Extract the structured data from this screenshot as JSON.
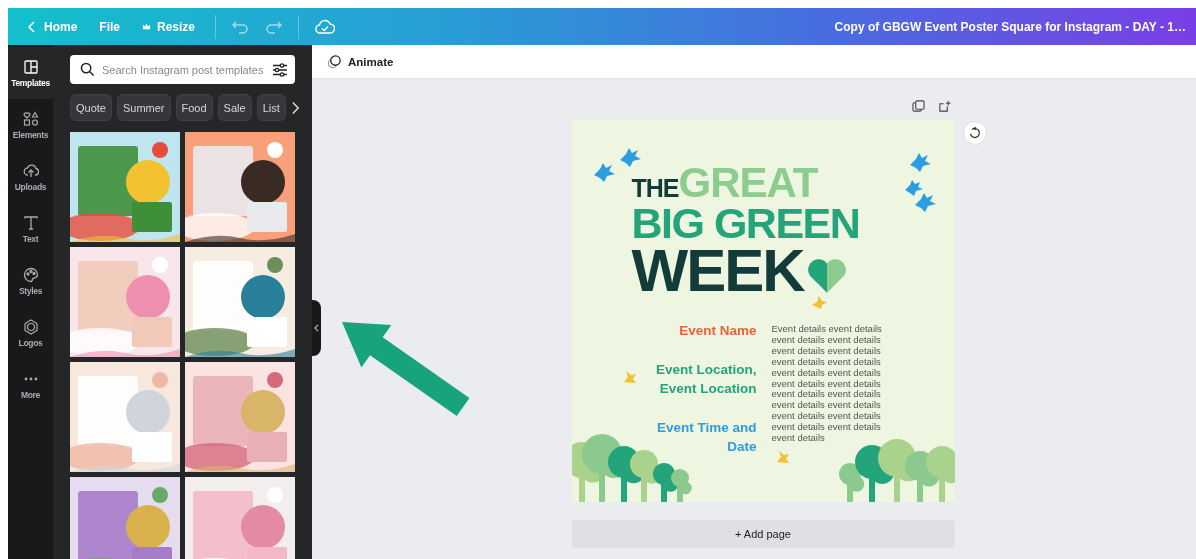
{
  "top_bar": {
    "home": "Home",
    "file": "File",
    "resize": "Resize",
    "title": "Copy of GBGW Event Poster Square for Instagram - DAY - 1…"
  },
  "rail": [
    {
      "label": "Templates",
      "selected": true,
      "kind": "templates"
    },
    {
      "label": "Elements",
      "selected": false,
      "kind": "elements"
    },
    {
      "label": "Uploads",
      "selected": false,
      "kind": "uploads"
    },
    {
      "label": "Text",
      "selected": false,
      "kind": "text"
    },
    {
      "label": "Styles",
      "selected": false,
      "kind": "styles"
    },
    {
      "label": "Logos",
      "selected": false,
      "kind": "logos"
    },
    {
      "label": "More",
      "selected": false,
      "kind": "more"
    }
  ],
  "panel": {
    "search": {
      "placeholder": "Search Instagram post templates"
    },
    "chips": [
      "Quote",
      "Summer",
      "Food",
      "Sale",
      "List"
    ]
  },
  "toolbar": {
    "animate": "Animate"
  },
  "poster": {
    "title": {
      "the": "THE",
      "great": "GREAT",
      "big_green": "BIG GREEN",
      "week": "WEEK"
    },
    "labels": [
      {
        "lines": [
          "Event Name"
        ],
        "color": "#e8633a"
      },
      {
        "lines": [
          "Event Location,",
          "Event Location"
        ],
        "color": "#23a47a"
      },
      {
        "lines": [
          "Event Time and",
          "Date"
        ],
        "color": "#2d9de0"
      }
    ],
    "details": [
      "Event details event details",
      "event details event details",
      "event details event details",
      "event details event details",
      "event details event details",
      "event details event details",
      "event details event details",
      "event details event details",
      "event details event details",
      "event details event details",
      "event details"
    ]
  },
  "add_page": "+ Add page"
}
